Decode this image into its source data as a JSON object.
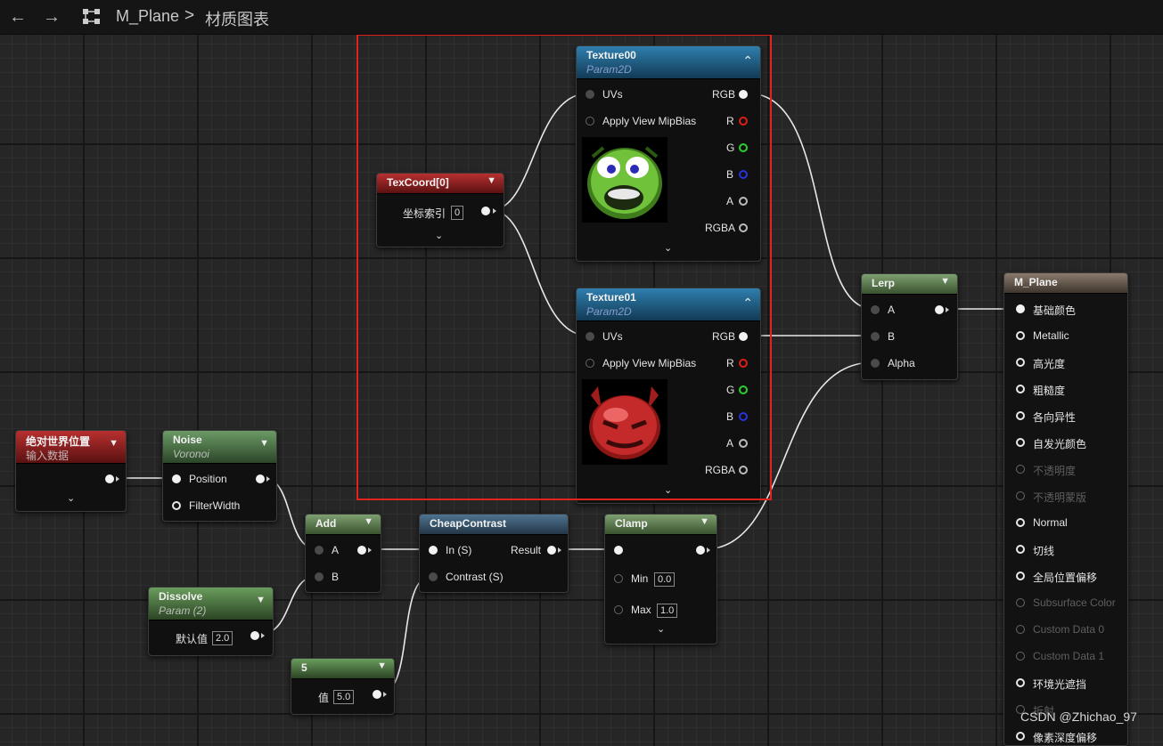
{
  "toolbar": {
    "back_icon": "arrow-left",
    "forward_icon": "arrow-right",
    "graph_icon": "blueprint-graph",
    "asset_name": "M_Plane",
    "separator": ">",
    "graph_name": "材质图表"
  },
  "nodes": {
    "texcoord": {
      "title": "TexCoord[0]",
      "coord_label": "坐标索引",
      "coord_value": "0"
    },
    "texture00": {
      "title": "Texture00",
      "subtitle": "Param2D",
      "in_uvs": "UVs",
      "in_mip": "Apply View MipBias",
      "out_rgb": "RGB",
      "out_r": "R",
      "out_g": "G",
      "out_b": "B",
      "out_a": "A",
      "out_rgba": "RGBA"
    },
    "texture01": {
      "title": "Texture01",
      "subtitle": "Param2D",
      "in_uvs": "UVs",
      "in_mip": "Apply View MipBias",
      "out_rgb": "RGB",
      "out_r": "R",
      "out_g": "G",
      "out_b": "B",
      "out_a": "A",
      "out_rgba": "RGBA"
    },
    "lerp": {
      "title": "Lerp",
      "in_a": "A",
      "in_b": "B",
      "in_alpha": "Alpha"
    },
    "world_pos": {
      "title": "绝对世界位置",
      "subtitle": "输入数据"
    },
    "noise": {
      "title": "Noise",
      "subtitle": "Voronoi",
      "in_position": "Position",
      "in_filterwidth": "FilterWidth"
    },
    "add": {
      "title": "Add",
      "in_a": "A",
      "in_b": "B"
    },
    "cheapcontrast": {
      "title": "CheapContrast",
      "in_s": "In (S)",
      "out_result": "Result",
      "in_contrast": "Contrast (S)"
    },
    "clamp": {
      "title": "Clamp",
      "min_label": "Min",
      "min_value": "0.0",
      "max_label": "Max",
      "max_value": "1.0"
    },
    "dissolve": {
      "title": "Dissolve",
      "subtitle": "Param (2)",
      "default_label": "默认值",
      "default_value": "2.0"
    },
    "const5": {
      "title": "5",
      "value_label": "值",
      "value": "5.0"
    },
    "material": {
      "title": "M_Plane",
      "pins": [
        {
          "label": "基础颜色",
          "enabled": true
        },
        {
          "label": "Metallic",
          "enabled": true
        },
        {
          "label": "高光度",
          "enabled": true
        },
        {
          "label": "粗糙度",
          "enabled": true
        },
        {
          "label": "各向异性",
          "enabled": true
        },
        {
          "label": "自发光颜色",
          "enabled": true
        },
        {
          "label": "不透明度",
          "enabled": false
        },
        {
          "label": "不透明蒙版",
          "enabled": false
        },
        {
          "label": "Normal",
          "enabled": true
        },
        {
          "label": "切线",
          "enabled": true
        },
        {
          "label": "全局位置偏移",
          "enabled": true
        },
        {
          "label": "Subsurface Color",
          "enabled": false
        },
        {
          "label": "Custom Data 0",
          "enabled": false
        },
        {
          "label": "Custom Data 1",
          "enabled": false
        },
        {
          "label": "环境光遮挡",
          "enabled": true
        },
        {
          "label": "折射",
          "enabled": false
        },
        {
          "label": "像素深度偏移",
          "enabled": true
        }
      ]
    }
  },
  "textures": {
    "texture00_thumb": {
      "icon": "green-monster-face",
      "colors": [
        "#6fc23a",
        "#2a5a12",
        "#ffffff",
        "#3030c0"
      ]
    },
    "texture01_thumb": {
      "icon": "red-devil-face",
      "colors": [
        "#c42a2a",
        "#ff8080",
        "#3a0a0a"
      ]
    }
  },
  "colors": {
    "selection_border": "#e0231c",
    "pin_r": "#e21a1a",
    "pin_g": "#2ad12a",
    "pin_b": "#2a32e0"
  },
  "watermark": "CSDN @Zhichao_97"
}
